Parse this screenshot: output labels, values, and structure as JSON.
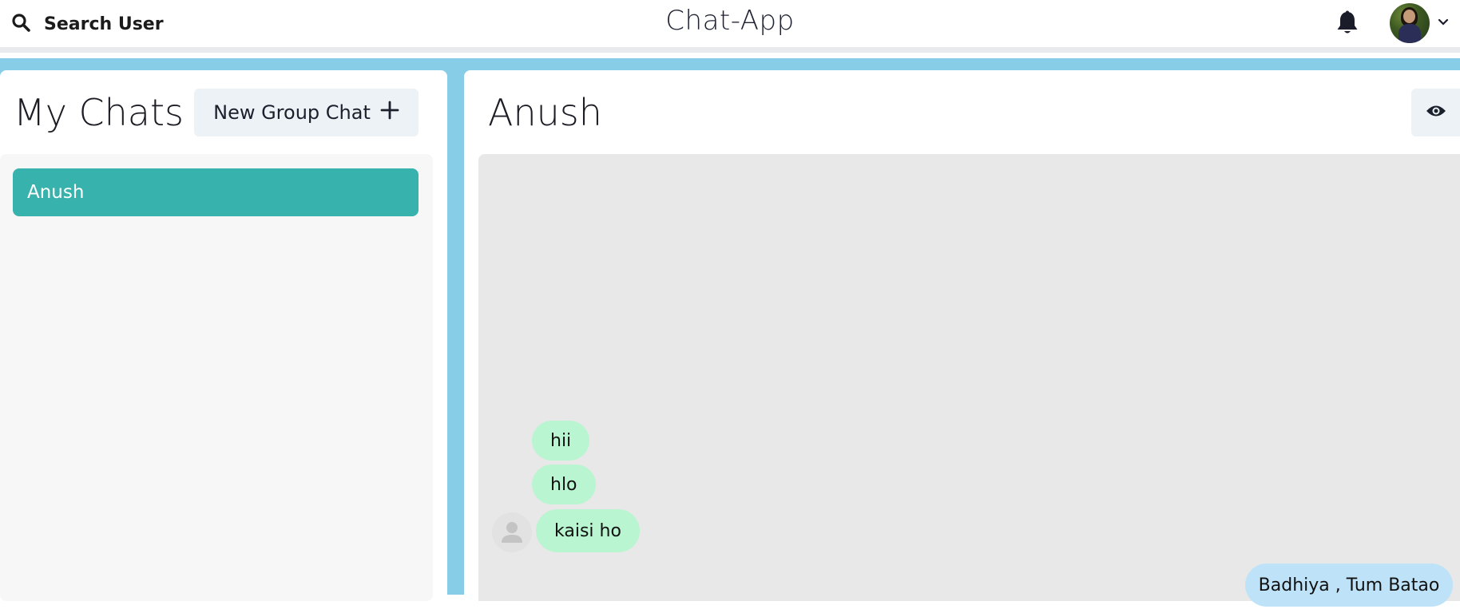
{
  "header": {
    "search_label": "Search User",
    "app_title": "Chat-App",
    "icons": {
      "search": "search-icon",
      "notifications": "bell-icon",
      "menu": "chevron-down-icon"
    }
  },
  "sidebar": {
    "title": "My Chats",
    "new_group_label": "New Group Chat",
    "chats": [
      {
        "name": "Anush",
        "selected": true
      }
    ]
  },
  "chat": {
    "title": "Anush",
    "messages": [
      {
        "text": "hii",
        "from": "Anush"
      },
      {
        "text": "hlo",
        "from": "Anush"
      },
      {
        "text": "kaisi ho",
        "from": "Anush"
      },
      {
        "text": "Badhiya , Tum Batao",
        "from": "me"
      }
    ]
  },
  "colors": {
    "accent_teal": "#38b2ac",
    "background_blue": "#87cde8",
    "received_bubble": "#b9f5d0",
    "sent_bubble": "#bee3f8"
  }
}
